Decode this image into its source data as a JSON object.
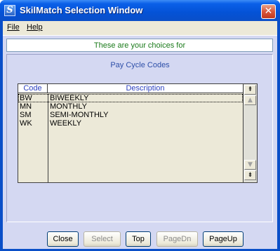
{
  "window": {
    "title": "SkilMatch Selection Window",
    "icon_letter": "S",
    "close_symbol": "✕"
  },
  "menu": {
    "file_label": "File",
    "help_label": "Help"
  },
  "banner": {
    "text": "These are your choices for"
  },
  "subtitle": "Pay Cycle Codes",
  "table": {
    "columns": [
      "Code",
      "Description"
    ],
    "rows": [
      {
        "code": "BW",
        "description": "BIWEEKLY"
      },
      {
        "code": "MN",
        "description": "MONTHLY"
      },
      {
        "code": "SM",
        "description": "SEMI-MONTHLY"
      },
      {
        "code": "WK",
        "description": "WEEKLY"
      }
    ]
  },
  "scrollbar": {
    "top_symbol": "⇞",
    "up_symbol": "▲",
    "down_symbol": "▼",
    "bottom_symbol": "⇟"
  },
  "buttons": {
    "close": "Close",
    "select": "Select",
    "top": "Top",
    "pagedn": "PageDn",
    "pageup": "PageUp"
  },
  "colors": {
    "titlebar": "#0452d6",
    "panel": "#d4d8f2",
    "banner_text": "#1a7a1a",
    "subtitle_text": "#2d4fa8",
    "header_text": "#2a3fbf"
  }
}
